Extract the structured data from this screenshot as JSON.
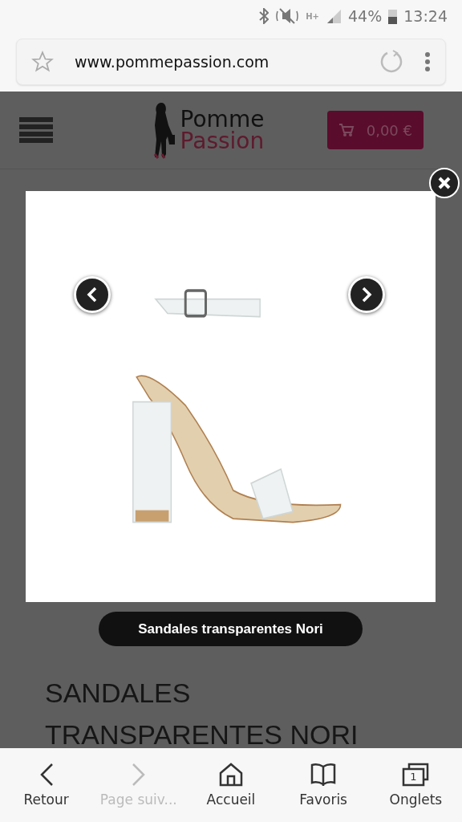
{
  "status_bar": {
    "network": "H+",
    "battery": "44%",
    "time": "13:24"
  },
  "url_bar": {
    "url": "www.pommepassion.com"
  },
  "site_header": {
    "logo_top": "Pomme",
    "logo_bottom": "Passion",
    "cart_total": "0,00 €"
  },
  "lightbox": {
    "caption": "Sandales transparentes Nori"
  },
  "product": {
    "title": "SANDALES TRANSPARENTES NORI"
  },
  "bottom_bar": [
    {
      "kind": "back",
      "label": "Retour",
      "disabled": false
    },
    {
      "kind": "forward",
      "label": "Page suiv...",
      "disabled": true
    },
    {
      "kind": "home",
      "label": "Accueil",
      "disabled": false
    },
    {
      "kind": "bookmarks",
      "label": "Favoris",
      "disabled": false
    },
    {
      "kind": "tabs",
      "label": "Onglets",
      "disabled": false,
      "count": "1"
    }
  ]
}
